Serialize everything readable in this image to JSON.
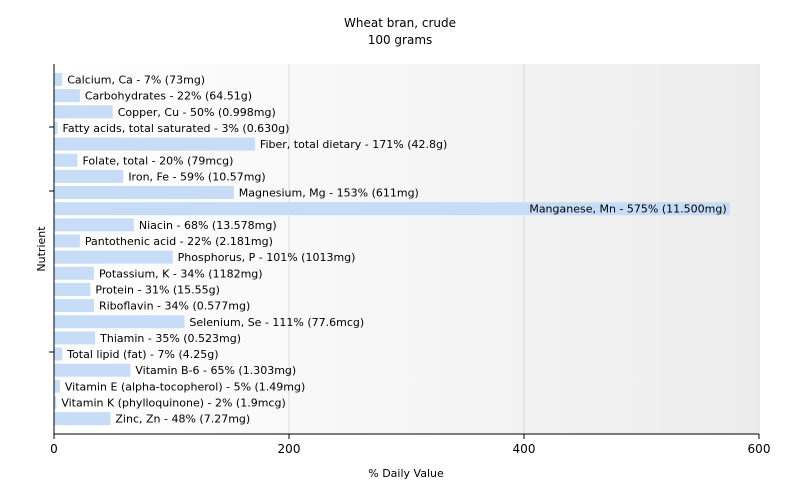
{
  "chart_data": {
    "type": "bar",
    "orientation": "horizontal",
    "title": "Wheat bran, crude",
    "subtitle": "100 grams",
    "xlabel": "% Daily Value",
    "ylabel": "Nutrient",
    "xlim": [
      0,
      600
    ],
    "xticks": [
      "0",
      "200",
      "400",
      "600"
    ],
    "grid": true,
    "bar_color": "#c6dcf7",
    "categories": [
      "Calcium, Ca",
      "Carbohydrates",
      "Copper, Cu",
      "Fatty acids, total saturated",
      "Fiber, total dietary",
      "Folate, total",
      "Iron, Fe",
      "Magnesium, Mg",
      "Manganese, Mn",
      "Niacin",
      "Pantothenic acid",
      "Phosphorus, P",
      "Potassium, K",
      "Protein",
      "Riboflavin",
      "Selenium, Se",
      "Thiamin",
      "Total lipid (fat)",
      "Vitamin B-6",
      "Vitamin E (alpha-tocopherol)",
      "Vitamin K (phylloquinone)",
      "Zinc, Zn"
    ],
    "values": [
      7,
      22,
      50,
      3,
      171,
      20,
      59,
      153,
      575,
      68,
      22,
      101,
      34,
      31,
      34,
      111,
      35,
      7,
      65,
      5,
      2,
      48
    ],
    "labels": [
      "Calcium, Ca - 7% (73mg)",
      "Carbohydrates - 22% (64.51g)",
      "Copper, Cu - 50% (0.998mg)",
      "Fatty acids, total saturated - 3% (0.630g)",
      "Fiber, total dietary - 171% (42.8g)",
      "Folate, total - 20% (79mcg)",
      "Iron, Fe - 59% (10.57mg)",
      "Magnesium, Mg - 153% (611mg)",
      "Manganese, Mn - 575% (11.500mg)",
      "Niacin - 68% (13.578mg)",
      "Pantothenic acid - 22% (2.181mg)",
      "Phosphorus, P - 101% (1013mg)",
      "Potassium, K - 34% (1182mg)",
      "Protein - 31% (15.55g)",
      "Riboflavin - 34% (0.577mg)",
      "Selenium, Se - 111% (77.6mcg)",
      "Thiamin - 35% (0.523mg)",
      "Total lipid (fat) - 7% (4.25g)",
      "Vitamin B-6 - 65% (1.303mg)",
      "Vitamin E (alpha-tocopherol) - 5% (1.49mg)",
      "Vitamin K (phylloquinone) - 2% (1.9mcg)",
      "Zinc, Zn - 48% (7.27mg)"
    ]
  }
}
